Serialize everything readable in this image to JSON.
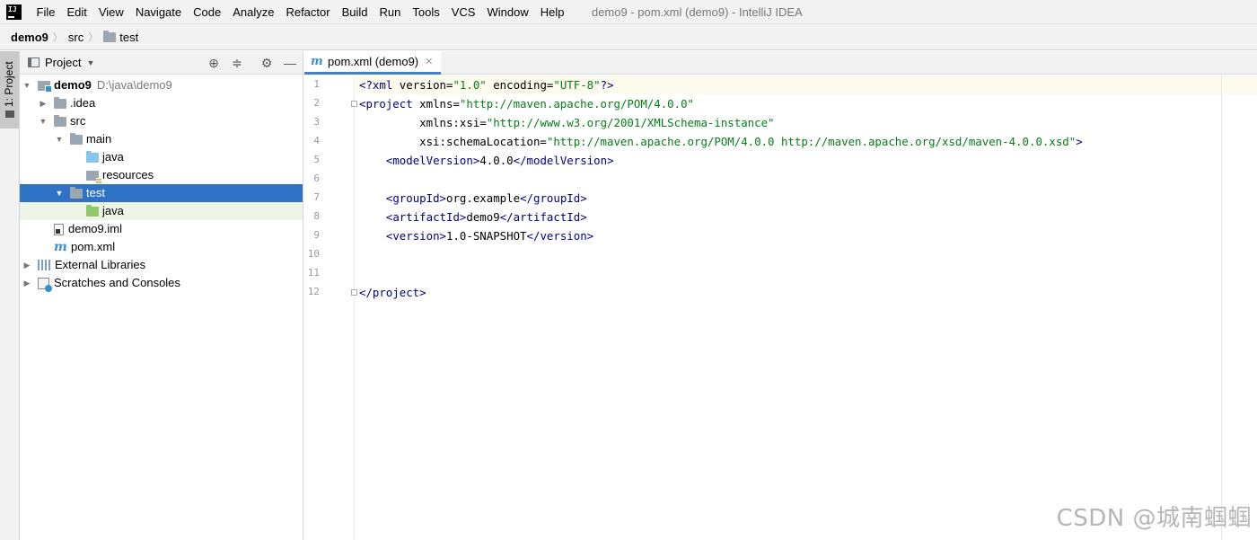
{
  "menubar": {
    "items": [
      "File",
      "Edit",
      "View",
      "Navigate",
      "Code",
      "Analyze",
      "Refactor",
      "Build",
      "Run",
      "Tools",
      "VCS",
      "Window",
      "Help"
    ],
    "window_title": "demo9 - pom.xml (demo9) - IntelliJ IDEA"
  },
  "breadcrumb": {
    "project": "demo9",
    "folder1": "src",
    "folder2": "test"
  },
  "tool_stripe": {
    "project_tab": "1: Project"
  },
  "project_panel": {
    "title": "Project",
    "tree": [
      {
        "label": "demo9",
        "hint": "D:\\java\\demo9",
        "expanded": true
      },
      {
        "label": ".idea"
      },
      {
        "label": "src"
      },
      {
        "label": "main"
      },
      {
        "label": "java"
      },
      {
        "label": "resources"
      },
      {
        "label": "test",
        "selected": true
      },
      {
        "label": "java"
      },
      {
        "label": "demo9.iml"
      },
      {
        "label": "pom.xml"
      },
      {
        "label": "External Libraries"
      },
      {
        "label": "Scratches and Consoles"
      }
    ]
  },
  "editor": {
    "tab_label": "pom.xml (demo9)",
    "line_numbers": [
      "1",
      "2",
      "3",
      "4",
      "5",
      "6",
      "7",
      "8",
      "9",
      "10",
      "11",
      "12"
    ],
    "lines": [
      "<?xml version=\"1.0\" encoding=\"UTF-8\"?>",
      "<project xmlns=\"http://maven.apache.org/POM/4.0.0\"",
      "         xmlns:xsi=\"http://www.w3.org/2001/XMLSchema-instance\"",
      "         xsi:schemaLocation=\"http://maven.apache.org/POM/4.0.0 http://maven.apache.org/xsd/maven-4.0.0.xsd\">",
      "    <modelVersion>4.0.0</modelVersion>",
      "",
      "    <groupId>org.example</groupId>",
      "    <artifactId>demo9</artifactId>",
      "    <version>1.0-SNAPSHOT</version>",
      "",
      "",
      "</project>"
    ]
  },
  "colors": {
    "selection": "#2e73c6",
    "tag": "#000080",
    "attribute": "#0000ff",
    "string": "#067d17"
  },
  "watermark": "CSDN @城南蝈蝈"
}
